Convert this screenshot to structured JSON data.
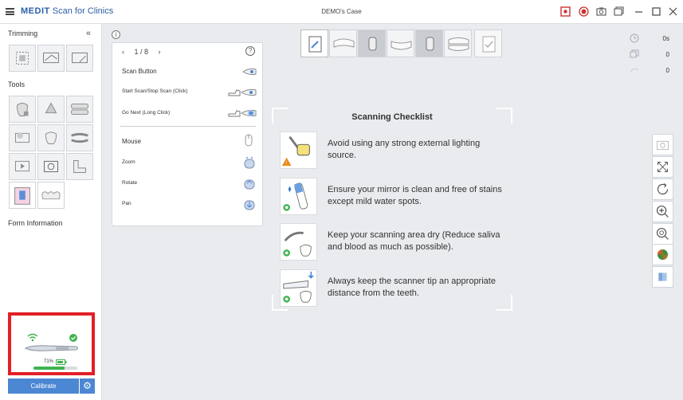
{
  "titlebar": {
    "brand_bold": "MEDIT",
    "brand_rest": "Scan for Clinics",
    "case_title": "DEMO's Case",
    "icons": [
      "menu-icon",
      "record-screen-icon",
      "record-icon",
      "camera-icon",
      "window-icon",
      "minimize-icon",
      "maximize-icon",
      "close-icon"
    ]
  },
  "sidebar": {
    "trimming_label": "Trimming",
    "tools_label": "Tools",
    "form_info_label": "Form Information",
    "collapse_glyph": "«",
    "trimming_tools": [
      "select-area-icon",
      "lock-area-icon",
      "erase-icon"
    ],
    "tools": [
      "tooth-lock-icon",
      "stone-icon",
      "occlusion-icon",
      "monitor-icon",
      "tooth-drill-icon",
      "bite-icon",
      "video-icon",
      "photo-icon",
      "ruler-icon",
      "scanner-photo-icon",
      "teeth-library-icon"
    ]
  },
  "device": {
    "battery_text": "71%",
    "battery_level": 0.71,
    "status": "connected",
    "calibrate_label": "Calibrate",
    "accent": "#4c87d4",
    "highlight": "#e21f26"
  },
  "guide": {
    "page": "1 / 8",
    "help": "?",
    "info": "i",
    "rows": [
      {
        "label": "Scan Button",
        "icon": "scan-button-icon"
      },
      {
        "label": "Start Scan/Stop Scan (Click)",
        "icon": "hand-click-icon"
      },
      {
        "label": "Go Next (Long Click)",
        "icon": "hand-long-click-icon"
      },
      {
        "label": "Mouse",
        "icon": "mouse-icon"
      },
      {
        "label": "Zoom",
        "icon": "zoom-gesture-icon"
      },
      {
        "label": "Rotate",
        "icon": "rotate-gesture-icon"
      },
      {
        "label": "Pan",
        "icon": "pan-gesture-icon"
      }
    ]
  },
  "steps": [
    "form-icon",
    "upper-jaw-icon",
    "upper-die-icon",
    "lower-jaw-icon",
    "lower-die-icon",
    "occlusion-icon",
    "check-icon"
  ],
  "stats": [
    {
      "icon": "clock-icon",
      "value": "0s"
    },
    {
      "icon": "frames-icon",
      "value": "0"
    },
    {
      "icon": "data-icon",
      "value": "0"
    }
  ],
  "checklist": {
    "title": "Scanning Checklist",
    "items": [
      {
        "text": "Avoid using any strong external lighting source.",
        "status": "warning"
      },
      {
        "text": "Ensure your mirror is clean and free of stains except mild water spots.",
        "status": "ok"
      },
      {
        "text": "Keep your scanning area dry (Reduce saliva and blood as much as possible).",
        "status": "ok"
      },
      {
        "text": "Always keep the scanner tip an appropriate distance from the teeth.",
        "status": "ok"
      }
    ]
  },
  "right_tools": [
    "screenshot-icon",
    "fit-icon",
    "reset-rotation-icon",
    "zoom-icon",
    "zoom-area-icon",
    "color-sphere-icon",
    "texture-icon"
  ]
}
